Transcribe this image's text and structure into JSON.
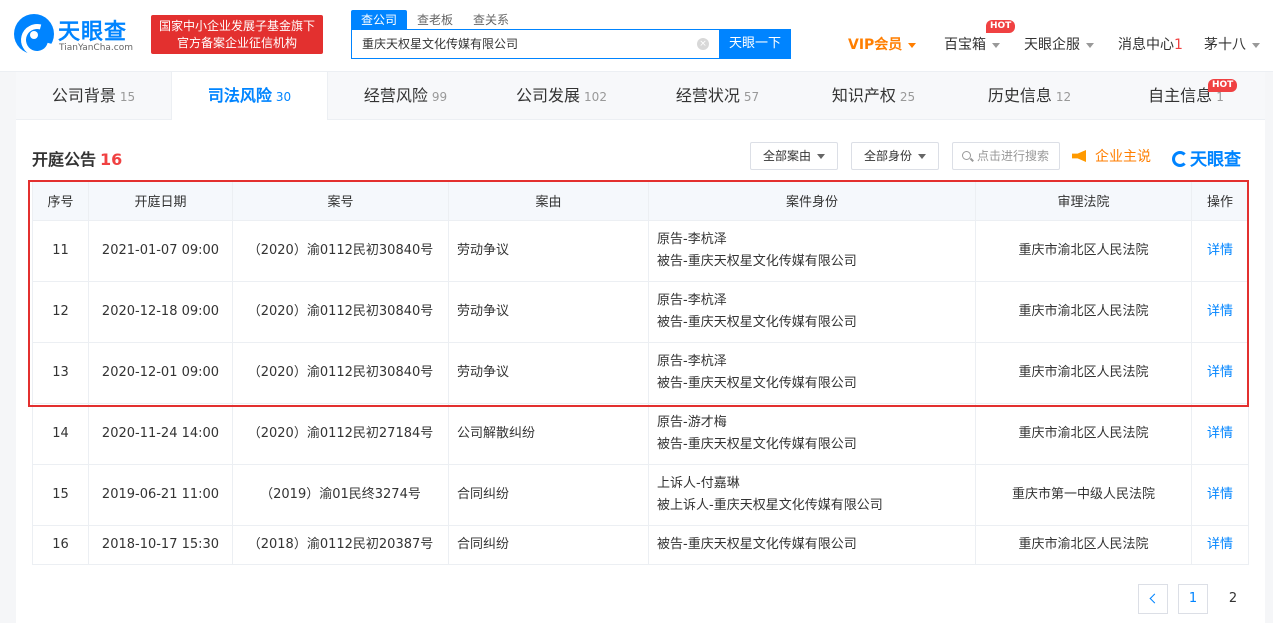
{
  "brand": {
    "logo_title": "天眼查",
    "logo_sub": "TianYanCha.com",
    "badge_line1": "国家中小企业发展子基金旗下",
    "badge_line2": "官方备案企业征信机构"
  },
  "search": {
    "tabs": [
      "查公司",
      "查老板",
      "查关系"
    ],
    "value": "重庆天权星文化传媒有限公司",
    "button": "天眼一下"
  },
  "nav": {
    "vip": "VIP会员",
    "toolbox": "百宝箱",
    "hot": "HOT",
    "enterprise": "天眼企服",
    "messages": "消息中心",
    "messages_count": "1",
    "user": "茅十八"
  },
  "tabs": [
    {
      "label": "公司背景",
      "count": "15"
    },
    {
      "label": "司法风险",
      "count": "30"
    },
    {
      "label": "经营风险",
      "count": "99"
    },
    {
      "label": "公司发展",
      "count": "102"
    },
    {
      "label": "经营状况",
      "count": "57"
    },
    {
      "label": "知识产权",
      "count": "25"
    },
    {
      "label": "历史信息",
      "count": "12"
    },
    {
      "label": "自主信息",
      "count": "1"
    }
  ],
  "section": {
    "title": "开庭公告",
    "count": "16",
    "filter_reason": "全部案由",
    "filter_role": "全部身份",
    "search_placeholder": "点击进行搜索",
    "zhushuo": "企业主说",
    "mini_logo": "天眼查"
  },
  "table": {
    "headers": [
      "序号",
      "开庭日期",
      "案号",
      "案由",
      "案件身份",
      "审理法院",
      "操作"
    ],
    "rows": [
      {
        "no": "11",
        "date": "2021-01-07 09:00",
        "case_no": "（2020）渝0112民初30840号",
        "reason": "劳动争议",
        "role1": "原告-李杭泽",
        "role2": "被告-重庆天权星文化传媒有限公司",
        "court": "重庆市渝北区人民法院",
        "action": "详情"
      },
      {
        "no": "12",
        "date": "2020-12-18 09:00",
        "case_no": "（2020）渝0112民初30840号",
        "reason": "劳动争议",
        "role1": "原告-李杭泽",
        "role2": "被告-重庆天权星文化传媒有限公司",
        "court": "重庆市渝北区人民法院",
        "action": "详情"
      },
      {
        "no": "13",
        "date": "2020-12-01 09:00",
        "case_no": "（2020）渝0112民初30840号",
        "reason": "劳动争议",
        "role1": "原告-李杭泽",
        "role2": "被告-重庆天权星文化传媒有限公司",
        "court": "重庆市渝北区人民法院",
        "action": "详情"
      },
      {
        "no": "14",
        "date": "2020-11-24 14:00",
        "case_no": "（2020）渝0112民初27184号",
        "reason": "公司解散纠纷",
        "role1": "原告-游才梅",
        "role2": "被告-重庆天权星文化传媒有限公司",
        "court": "重庆市渝北区人民法院",
        "action": "详情"
      },
      {
        "no": "15",
        "date": "2019-06-21 11:00",
        "case_no": "（2019）渝01民终3274号",
        "reason": "合同纠纷",
        "role1": "上诉人-付嘉琳",
        "role2": "被上诉人-重庆天权星文化传媒有限公司",
        "court": "重庆市第一中级人民法院",
        "action": "详情"
      },
      {
        "no": "16",
        "date": "2018-10-17 15:30",
        "case_no": "（2018）渝0112民初20387号",
        "reason": "合同纠纷",
        "role1": "被告-重庆天权星文化传媒有限公司",
        "role2": "",
        "court": "重庆市渝北区人民法院",
        "action": "详情"
      }
    ]
  },
  "pagination": {
    "page1": "1",
    "page2": "2"
  },
  "colors": {
    "brand_blue": "#0084ff",
    "alert_red": "#e3302f",
    "vip_orange": "#ff7e00"
  }
}
